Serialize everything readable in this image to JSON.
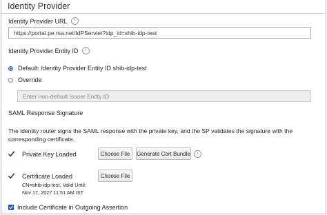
{
  "section_title": "Identity Provider",
  "idp_url": {
    "label": "Identity Provider URL",
    "value": "https://portal.pe.rsa.net/IdPServlet?idp_id=shib-idp-test"
  },
  "entity_id": {
    "label": "Identity Provider Entity ID",
    "default_option": "Default: Identity Provider Entity ID shib-idp-test",
    "override_option": "Override",
    "override_placeholder": "Enter non-default Issuer Entity ID",
    "selected": "default"
  },
  "saml": {
    "label": "SAML Response Signature",
    "description": "The identity router signs the SAML response with the private key, and the SP validates the signature with the corresponding certificate.",
    "private_key": {
      "status": "Private Key Loaded",
      "choose_file": "Choose File",
      "generate": "Generate Cert Bundle"
    },
    "certificate": {
      "status": "Certificate Loaded",
      "details_line1": "CN=shib-idp-test, Valid Until:",
      "details_line2": "Nov 17, 2027 11:51 AM IST",
      "choose_file": "Choose File"
    },
    "include_cert": {
      "label": "Include Certificate in Outgoing Assertion",
      "checked": true
    }
  },
  "icons": {
    "info": "i",
    "status_check": "checkmark-icon"
  },
  "colors": {
    "accent": "#1a56db",
    "check": "#1f3f7a"
  }
}
